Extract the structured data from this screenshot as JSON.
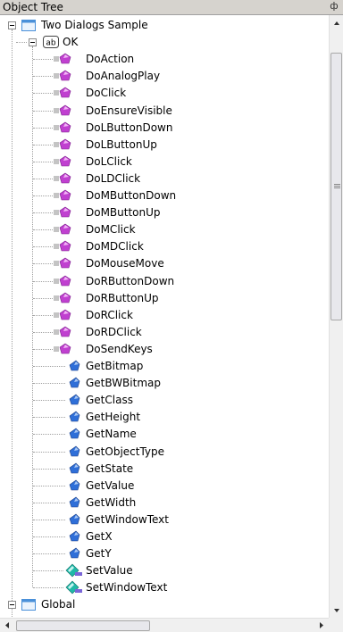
{
  "panel": {
    "title": "Object Tree",
    "pin_glyph": "ф"
  },
  "tree": {
    "root": {
      "label": "Two Dialogs Sample",
      "icon": "window-icon",
      "expanded": true
    },
    "child": {
      "label": "OK",
      "icon": "button-ab-icon",
      "expanded": true
    },
    "methods": [
      {
        "label": "DoAction",
        "icon": "action-method-icon"
      },
      {
        "label": "DoAnalogPlay",
        "icon": "action-method-icon"
      },
      {
        "label": "DoClick",
        "icon": "action-method-icon"
      },
      {
        "label": "DoEnsureVisible",
        "icon": "action-method-icon"
      },
      {
        "label": "DoLButtonDown",
        "icon": "action-method-icon"
      },
      {
        "label": "DoLButtonUp",
        "icon": "action-method-icon"
      },
      {
        "label": "DoLClick",
        "icon": "action-method-icon"
      },
      {
        "label": "DoLDClick",
        "icon": "action-method-icon"
      },
      {
        "label": "DoMButtonDown",
        "icon": "action-method-icon"
      },
      {
        "label": "DoMButtonUp",
        "icon": "action-method-icon"
      },
      {
        "label": "DoMClick",
        "icon": "action-method-icon"
      },
      {
        "label": "DoMDClick",
        "icon": "action-method-icon"
      },
      {
        "label": "DoMouseMove",
        "icon": "action-method-icon"
      },
      {
        "label": "DoRButtonDown",
        "icon": "action-method-icon"
      },
      {
        "label": "DoRButtonUp",
        "icon": "action-method-icon"
      },
      {
        "label": "DoRClick",
        "icon": "action-method-icon"
      },
      {
        "label": "DoRDClick",
        "icon": "action-method-icon"
      },
      {
        "label": "DoSendKeys",
        "icon": "action-method-icon"
      },
      {
        "label": "GetBitmap",
        "icon": "get-method-icon"
      },
      {
        "label": "GetBWBitmap",
        "icon": "get-method-icon"
      },
      {
        "label": "GetClass",
        "icon": "get-method-icon"
      },
      {
        "label": "GetHeight",
        "icon": "get-method-icon"
      },
      {
        "label": "GetName",
        "icon": "get-method-icon"
      },
      {
        "label": "GetObjectType",
        "icon": "get-method-icon"
      },
      {
        "label": "GetState",
        "icon": "get-method-icon"
      },
      {
        "label": "GetValue",
        "icon": "get-method-icon"
      },
      {
        "label": "GetWidth",
        "icon": "get-method-icon"
      },
      {
        "label": "GetWindowText",
        "icon": "get-method-icon"
      },
      {
        "label": "GetX",
        "icon": "get-method-icon"
      },
      {
        "label": "GetY",
        "icon": "get-method-icon"
      },
      {
        "label": "SetValue",
        "icon": "set-method-icon"
      },
      {
        "label": "SetWindowText",
        "icon": "set-method-icon"
      }
    ],
    "next_root": {
      "label": "Global",
      "icon": "window-icon"
    }
  },
  "colors": {
    "action": "#c040d0",
    "get": "#2f6fd8",
    "set": "#20b8a8",
    "window": "#4a90d9"
  }
}
